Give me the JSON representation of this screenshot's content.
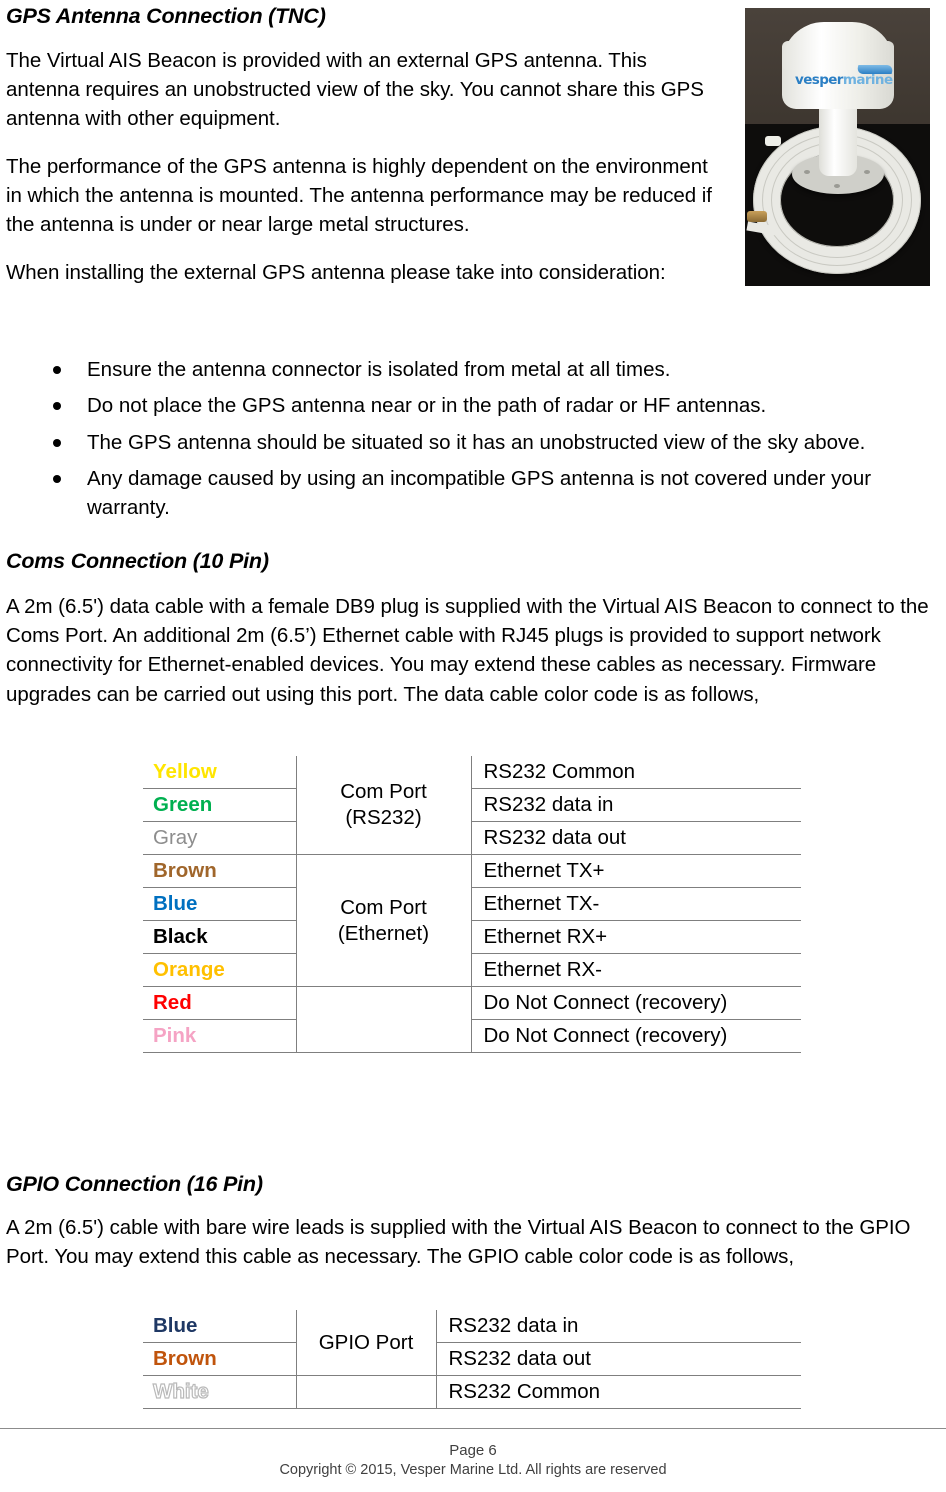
{
  "document": {
    "sections": [
      {
        "id": "gps-antenna",
        "heading": "GPS Antenna Connection (TNC)",
        "paragraphs": [
          "The Virtual AIS Beacon is provided with an external GPS antenna. This antenna requires an unobstructed view of the sky. You cannot share this GPS antenna with other equipment.",
          "The performance of the GPS antenna is highly dependent on the environment in which the antenna is mounted.  The antenna performance may be reduced if the antenna is under or near large metal structures.",
          "When installing the external GPS antenna please take into consideration:"
        ],
        "bullets": [
          "Ensure the antenna connector is isolated from metal at all times.",
          "Do not place the GPS antenna near or in the path of radar or HF antennas.",
          "The GPS antenna should be situated so it has an unobstructed view of the sky above.",
          "Any damage caused by using an incompatible GPS antenna is not covered under your warranty."
        ]
      },
      {
        "id": "coms-connection",
        "heading": "Coms Connection (10 Pin)",
        "paragraphs": [
          "A 2m (6.5') data cable with a female DB9 plug is supplied with the Virtual AIS Beacon to connect to the Coms Port. An additional 2m (6.5’) Ethernet cable with RJ45 plugs is provided to support network connectivity for Ethernet-enabled devices. You may extend these cables as necessary. Firmware upgrades can be carried out using this port. The data cable color code is as follows,"
        ]
      },
      {
        "id": "gpio-connection",
        "heading": " GPIO Connection (16 Pin)",
        "paragraphs": [
          "A 2m (6.5') cable with bare wire leads is supplied with the Virtual AIS Beacon to connect to the GPIO Port. You may extend this cable as necessary. The GPIO cable color code is as follows,"
        ]
      }
    ]
  },
  "photo": {
    "alt_name": "gps-antenna-photo",
    "brand_primary": "vesper",
    "brand_secondary": "marine"
  },
  "coms_table": {
    "rows": [
      {
        "color": "Yellow",
        "swatch": "#FFE500",
        "css": "c-yellow",
        "port": "Com Port\n(RS232)",
        "desc": "RS232 Common"
      },
      {
        "color": "Green",
        "swatch": "#00B050",
        "css": "c-green",
        "port": "",
        "desc": "RS232 data in"
      },
      {
        "color": "Gray",
        "swatch": "#8D8D8D",
        "css": "c-gray",
        "port": "",
        "desc": "RS232 data out"
      },
      {
        "color": "Brown",
        "swatch": "#A0662B",
        "css": "c-brown",
        "port": "Com Port\n(Ethernet)",
        "desc": "Ethernet TX+"
      },
      {
        "color": "Blue",
        "swatch": "#0070C0",
        "css": "c-blue",
        "port": "",
        "desc": "Ethernet TX-"
      },
      {
        "color": "Black",
        "swatch": "#000000",
        "css": "c-black",
        "port": "",
        "desc": "Ethernet RX+"
      },
      {
        "color": "Orange",
        "swatch": "#FFC000",
        "css": "c-orange",
        "port": "",
        "desc": "Ethernet RX-"
      },
      {
        "color": "Red",
        "swatch": "#FF0000",
        "css": "c-red",
        "port": "",
        "desc": "Do Not Connect (recovery)"
      },
      {
        "color": "Pink",
        "swatch": "#F5A3C4",
        "css": "c-pink",
        "port": "",
        "desc": "Do Not Connect (recovery)"
      }
    ],
    "port_labels": {
      "rs232_line1": "Com Port",
      "rs232_line2": "(RS232)",
      "ethernet_line1": "Com Port",
      "ethernet_line2": "(Ethernet)"
    }
  },
  "gpio_table": {
    "port_label": "GPIO Port",
    "rows": [
      {
        "color": "Blue",
        "swatch": "#1F3864",
        "css": "c-navy",
        "desc": "RS232 data in"
      },
      {
        "color": "Brown",
        "swatch": "#C0540C",
        "css": "c-brown2",
        "desc": "RS232 data out"
      },
      {
        "color": "White",
        "swatch": "#FFFFFF",
        "css": "c-white",
        "desc": "RS232 Common"
      }
    ]
  },
  "footer": {
    "page": "Page 6",
    "copyright": "Copyright © 2015, Vesper Marine Ltd. All rights are reserved"
  }
}
